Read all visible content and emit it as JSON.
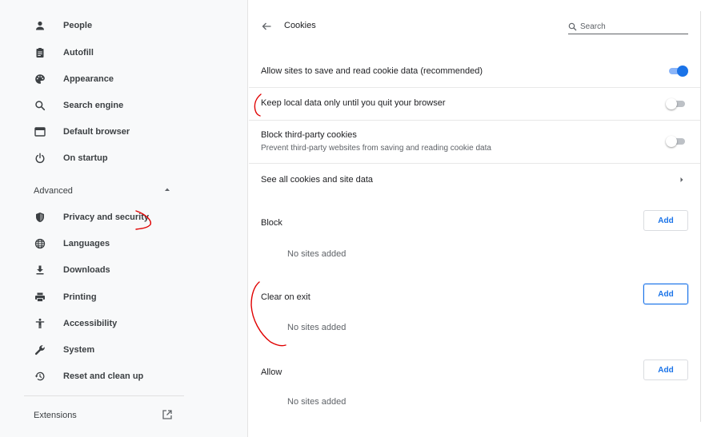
{
  "colors": {
    "accent": "#1a73e8",
    "annotation": "#e00000",
    "sidebar_bg": "#f8f9fa"
  },
  "sidebar": {
    "items": [
      {
        "label": "People",
        "icon": "person-icon"
      },
      {
        "label": "Autofill",
        "icon": "clipboard-icon"
      },
      {
        "label": "Appearance",
        "icon": "palette-icon"
      },
      {
        "label": "Search engine",
        "icon": "search-icon"
      },
      {
        "label": "Default browser",
        "icon": "browser-window-icon"
      },
      {
        "label": "On startup",
        "icon": "power-icon"
      }
    ],
    "advanced_label": "Advanced",
    "advanced_items": [
      {
        "label": "Privacy and security",
        "icon": "shield-icon"
      },
      {
        "label": "Languages",
        "icon": "globe-icon"
      },
      {
        "label": "Downloads",
        "icon": "download-icon"
      },
      {
        "label": "Printing",
        "icon": "printer-icon"
      },
      {
        "label": "Accessibility",
        "icon": "accessibility-icon"
      },
      {
        "label": "System",
        "icon": "wrench-icon"
      },
      {
        "label": "Reset and clean up",
        "icon": "restore-icon"
      }
    ],
    "extensions_label": "Extensions"
  },
  "header": {
    "title": "Cookies",
    "search_placeholder": "Search"
  },
  "settings": {
    "allow_sites": {
      "label": "Allow sites to save and read cookie data (recommended)",
      "enabled": true
    },
    "keep_local": {
      "label": "Keep local data only until you quit your browser",
      "enabled": false
    },
    "block_third_party": {
      "label": "Block third-party cookies",
      "sublabel": "Prevent third-party websites from saving and reading cookie data",
      "enabled": false
    },
    "see_all": {
      "label": "See all cookies and site data"
    }
  },
  "sections": {
    "block": {
      "title": "Block",
      "add_label": "Add",
      "empty": "No sites added"
    },
    "clear_on_exit": {
      "title": "Clear on exit",
      "add_label": "Add",
      "empty": "No sites added"
    },
    "allow": {
      "title": "Allow",
      "add_label": "Add",
      "empty": "No sites added"
    }
  }
}
